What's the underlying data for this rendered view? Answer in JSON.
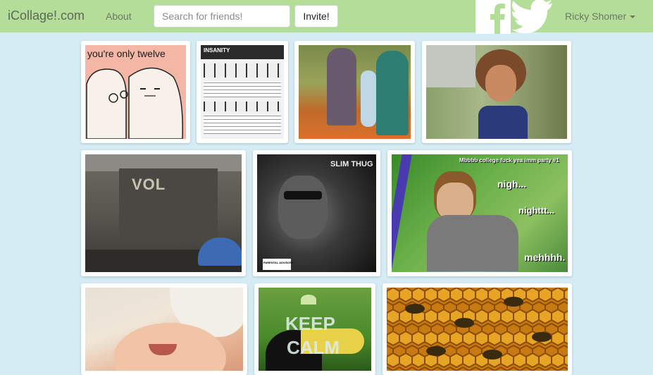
{
  "navbar": {
    "brand": "iCollage!.com",
    "about_label": "About",
    "search_placeholder": "Search for friends!",
    "invite_label": "Invite!",
    "user_name": "Ricky Shomer",
    "colors": {
      "bar": "#b3dd98",
      "page": "#d5ecf5"
    },
    "icons": [
      "facebook-icon",
      "twitter-icon",
      "caret-down-icon"
    ]
  },
  "collage": {
    "images": [
      {
        "name": "youre-only-twelve-comic",
        "caption": "you're only twelve"
      },
      {
        "name": "insanity-workout-chart",
        "caption": "INSANITY"
      },
      {
        "name": "pumpkin-patch-family-photo",
        "caption": ""
      },
      {
        "name": "curly-haired-toddler-photo",
        "caption": ""
      },
      {
        "name": "volbeat-concert-photo",
        "caption": "VOL"
      },
      {
        "name": "slim-thug-album-cover",
        "caption": "SLIM THUG",
        "badge": "PARENTAL ADVISORY"
      },
      {
        "name": "college-meme",
        "caption": "Mbbbb college fuck yea imm party #1",
        "lines": [
          "nigh...",
          "nighttt...",
          "mehhhh."
        ]
      },
      {
        "name": "laughing-baby-photo",
        "caption": ""
      },
      {
        "name": "keep-calm-toucan",
        "caption": "KEEP",
        "caption2": "CALM"
      },
      {
        "name": "honeycomb-bees-photo",
        "caption": ""
      }
    ]
  }
}
